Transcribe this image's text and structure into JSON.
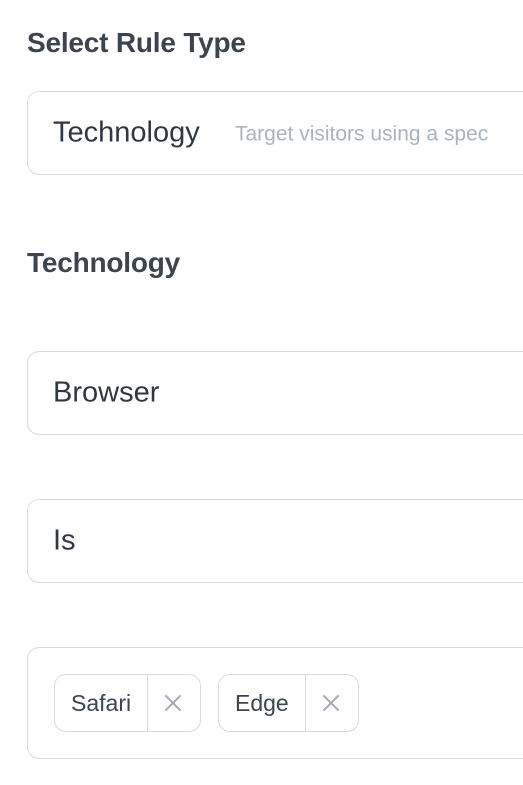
{
  "rule_type_section": {
    "heading": "Select Rule Type",
    "selected_value": "Technology",
    "selected_description": "Target visitors using a spec"
  },
  "technology_section": {
    "heading": "Technology",
    "property_select": {
      "value": "Browser"
    },
    "operator_select": {
      "value": "Is"
    },
    "values_select": {
      "chips": [
        {
          "label": "Safari",
          "remove_icon": "close-icon"
        },
        {
          "label": "Edge",
          "remove_icon": "close-icon"
        }
      ]
    }
  }
}
